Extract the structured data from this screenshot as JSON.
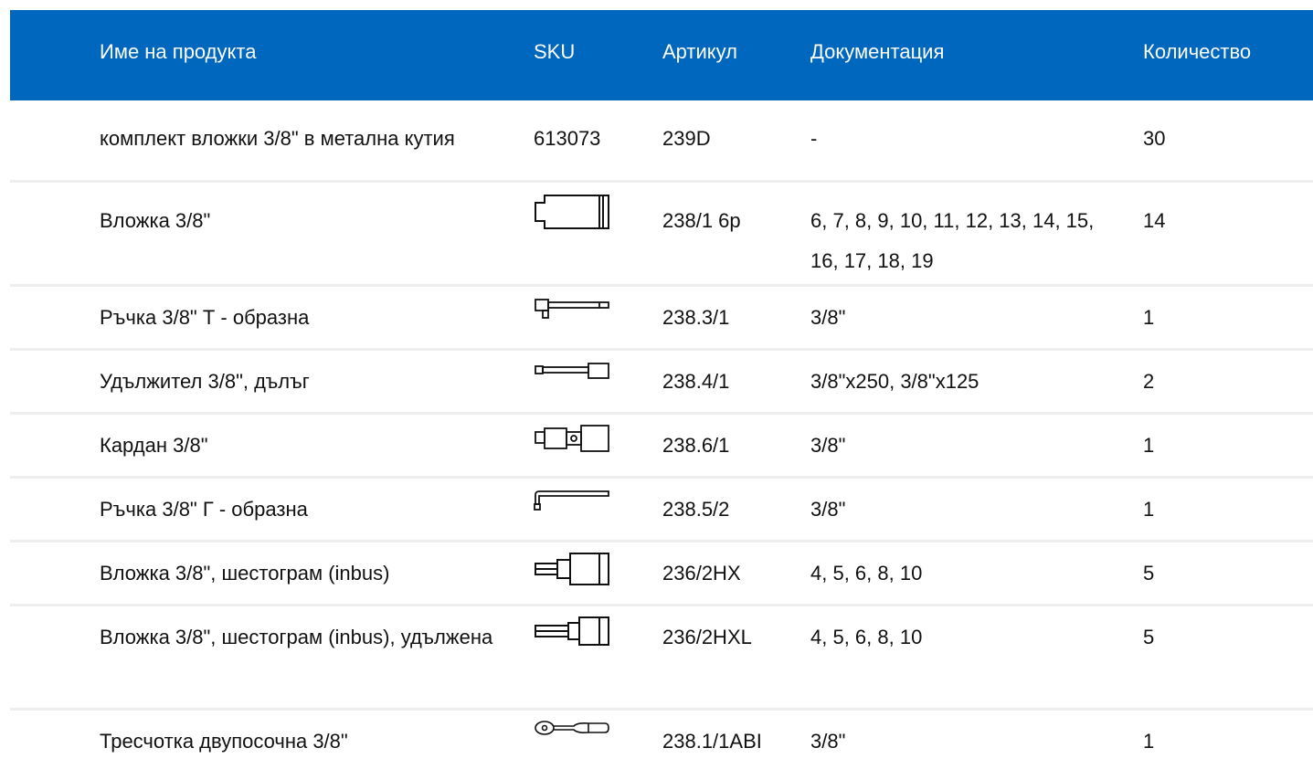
{
  "colors": {
    "header_bg": "#0067be",
    "header_text": "#ffffff",
    "row_divider": "#eeeeee"
  },
  "header": {
    "name": "Име на продукта",
    "sku": "SKU",
    "article": "Артикул",
    "documentation": "Документация",
    "quantity": "Количество"
  },
  "rows": [
    {
      "name": "комплект вложки 3/8\" в метална кутия",
      "sku": "613073",
      "article": "239D",
      "documentation": "-",
      "quantity": "30"
    },
    {
      "name": "Вложка 3/8\"",
      "sku_icon": "socket-icon",
      "article": "238/1 6р",
      "documentation": "6, 7, 8, 9, 10, 11, 12, 13, 14, 15, 16, 17, 18, 19",
      "quantity": "14"
    },
    {
      "name": "Ръчка 3/8\" Т - образна",
      "sku_icon": "t-handle-icon",
      "article": "238.3/1",
      "documentation": "3/8\"",
      "quantity": "1"
    },
    {
      "name": "Удължител 3/8\", дълъг",
      "sku_icon": "extension-bar-icon",
      "article": "238.4/1",
      "documentation": "3/8\"x250, 3/8\"x125",
      "quantity": "2"
    },
    {
      "name": "Кардан 3/8\"",
      "sku_icon": "universal-joint-icon",
      "article": "238.6/1",
      "documentation": "3/8\"",
      "quantity": "1"
    },
    {
      "name": "Ръчка 3/8\" Г - образна",
      "sku_icon": "l-handle-icon",
      "article": "238.5/2",
      "documentation": "3/8\"",
      "quantity": "1"
    },
    {
      "name": "Вложка 3/8\", шестограм (inbus)",
      "sku_icon": "hex-bit-socket-icon",
      "article": "236/2HX",
      "documentation": "4, 5, 6, 8, 10",
      "quantity": "5"
    },
    {
      "name": "Вложка 3/8\", шестограм (inbus), удължена",
      "sku_icon": "long-hex-bit-socket-icon",
      "article": "236/2HXL",
      "documentation": "4, 5, 6, 8, 10",
      "quantity": "5"
    },
    {
      "name": "Тресчотка двупосочна 3/8\"",
      "sku_icon": "ratchet-icon",
      "article": "238.1/1ABI",
      "documentation": "3/8\"",
      "quantity": "1"
    }
  ]
}
